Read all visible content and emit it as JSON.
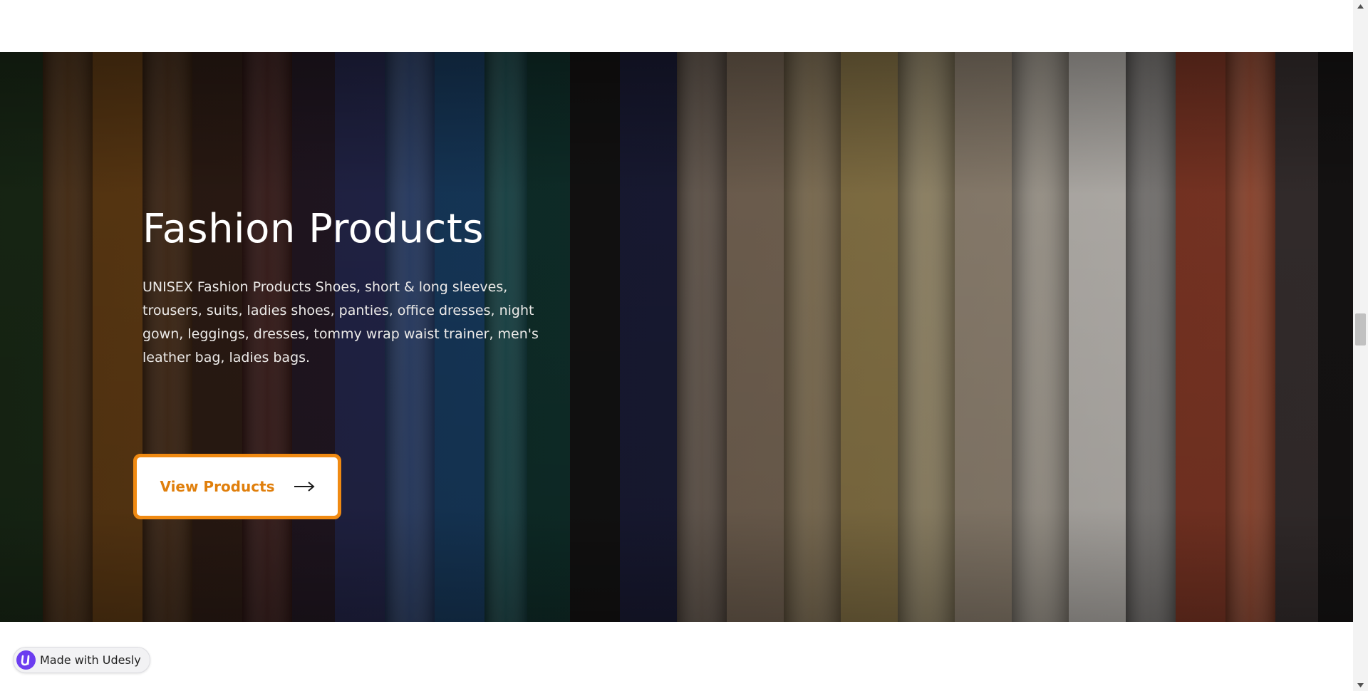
{
  "hero": {
    "title": "Fashion Products",
    "description": "UNISEX Fashion Products Shoes, short & long sleeves, trousers, suits, ladies shoes, panties, office dresses, night gown, leggings, dresses, tommy wrap waist trainer, men's leather bag, ladies bags.",
    "background_image": "clothes-rack-shirts",
    "cta": {
      "label": "View Products",
      "icon": "arrow-right-icon"
    }
  },
  "badge": {
    "label": "Made with Udesly",
    "logo_icon": "udesly-logo"
  },
  "colors": {
    "accent": "#f08a12",
    "cta_text": "#e07f0c",
    "badge_logo": "#6c3df0"
  }
}
